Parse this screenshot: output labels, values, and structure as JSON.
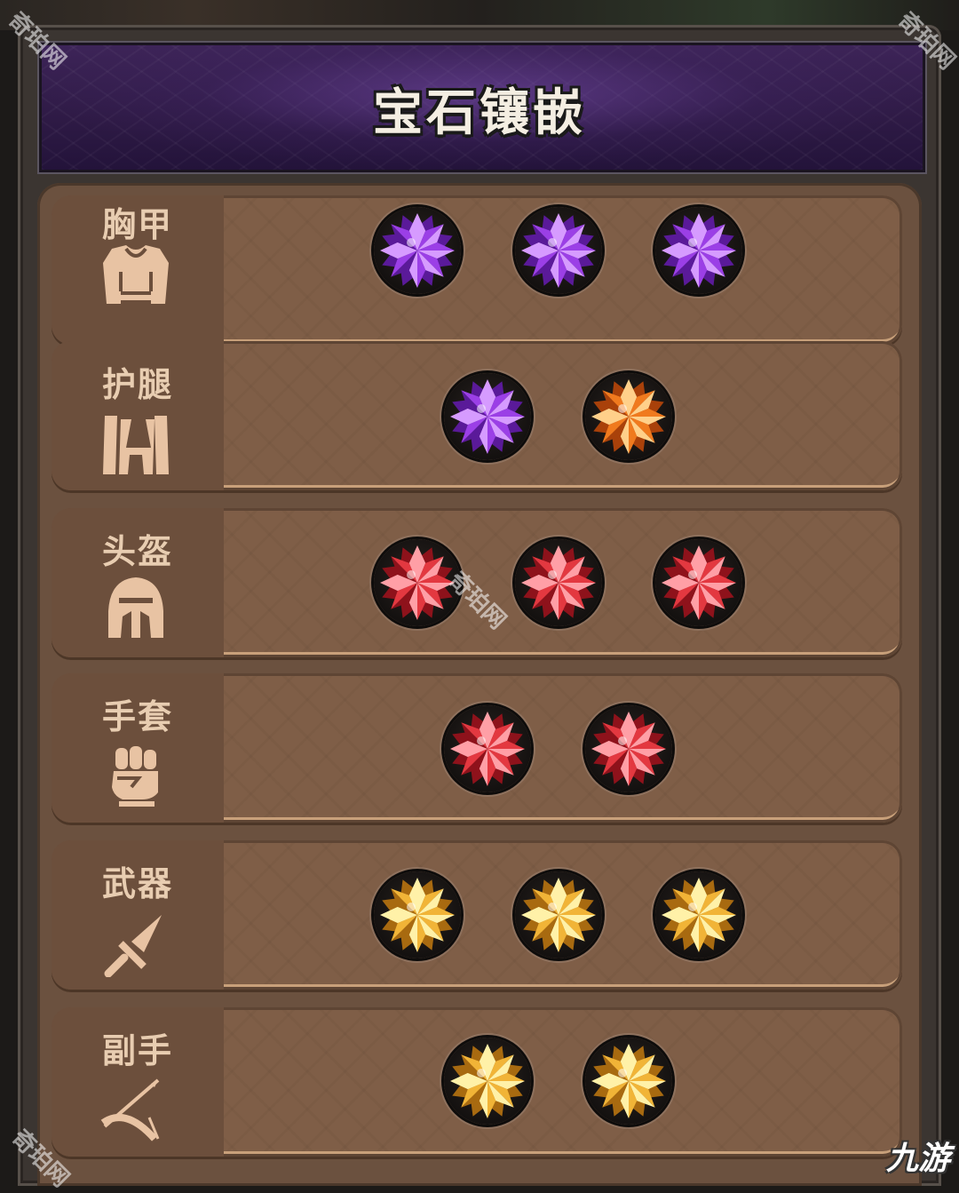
{
  "panel": {
    "title": "宝石镶嵌"
  },
  "slots": [
    {
      "label": "胸甲",
      "icon": "chest-armor-icon",
      "gems": [
        "purple",
        "purple",
        "purple"
      ]
    },
    {
      "label": "护腿",
      "icon": "leggings-icon",
      "gems": [
        "purple",
        "orange"
      ]
    },
    {
      "label": "头盔",
      "icon": "helmet-icon",
      "gems": [
        "red",
        "red",
        "red"
      ]
    },
    {
      "label": "手套",
      "icon": "gauntlet-fist-icon",
      "gems": [
        "red",
        "red"
      ]
    },
    {
      "label": "武器",
      "icon": "sword-icon",
      "gems": [
        "gold",
        "gold",
        "gold"
      ]
    },
    {
      "label": "副手",
      "icon": "bow-arrow-icon",
      "gems": [
        "gold",
        "gold"
      ]
    }
  ],
  "gem_colors": {
    "purple": {
      "light": "#d69bff",
      "mid": "#9b3fe6",
      "dark": "#5a1a99"
    },
    "orange": {
      "light": "#ffd08a",
      "mid": "#f07a1e",
      "dark": "#a9410a"
    },
    "red": {
      "light": "#ff9fa6",
      "mid": "#e33840",
      "dark": "#8e121b"
    },
    "gold": {
      "light": "#fff1a8",
      "mid": "#f1b437",
      "dark": "#a86a10"
    }
  },
  "watermark": {
    "text": "奇珀网",
    "logo": "九游"
  }
}
